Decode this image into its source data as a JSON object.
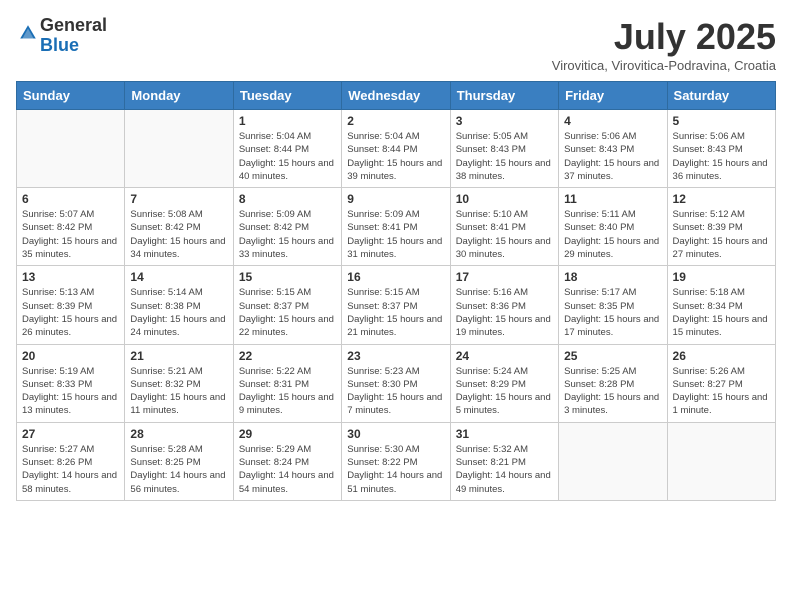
{
  "logo": {
    "general": "General",
    "blue": "Blue"
  },
  "title": "July 2025",
  "subtitle": "Virovitica, Virovitica-Podravina, Croatia",
  "days_of_week": [
    "Sunday",
    "Monday",
    "Tuesday",
    "Wednesday",
    "Thursday",
    "Friday",
    "Saturday"
  ],
  "weeks": [
    [
      {
        "day": "",
        "sunrise": "",
        "sunset": "",
        "daylight": ""
      },
      {
        "day": "",
        "sunrise": "",
        "sunset": "",
        "daylight": ""
      },
      {
        "day": "1",
        "sunrise": "Sunrise: 5:04 AM",
        "sunset": "Sunset: 8:44 PM",
        "daylight": "Daylight: 15 hours and 40 minutes."
      },
      {
        "day": "2",
        "sunrise": "Sunrise: 5:04 AM",
        "sunset": "Sunset: 8:44 PM",
        "daylight": "Daylight: 15 hours and 39 minutes."
      },
      {
        "day": "3",
        "sunrise": "Sunrise: 5:05 AM",
        "sunset": "Sunset: 8:43 PM",
        "daylight": "Daylight: 15 hours and 38 minutes."
      },
      {
        "day": "4",
        "sunrise": "Sunrise: 5:06 AM",
        "sunset": "Sunset: 8:43 PM",
        "daylight": "Daylight: 15 hours and 37 minutes."
      },
      {
        "day": "5",
        "sunrise": "Sunrise: 5:06 AM",
        "sunset": "Sunset: 8:43 PM",
        "daylight": "Daylight: 15 hours and 36 minutes."
      }
    ],
    [
      {
        "day": "6",
        "sunrise": "Sunrise: 5:07 AM",
        "sunset": "Sunset: 8:42 PM",
        "daylight": "Daylight: 15 hours and 35 minutes."
      },
      {
        "day": "7",
        "sunrise": "Sunrise: 5:08 AM",
        "sunset": "Sunset: 8:42 PM",
        "daylight": "Daylight: 15 hours and 34 minutes."
      },
      {
        "day": "8",
        "sunrise": "Sunrise: 5:09 AM",
        "sunset": "Sunset: 8:42 PM",
        "daylight": "Daylight: 15 hours and 33 minutes."
      },
      {
        "day": "9",
        "sunrise": "Sunrise: 5:09 AM",
        "sunset": "Sunset: 8:41 PM",
        "daylight": "Daylight: 15 hours and 31 minutes."
      },
      {
        "day": "10",
        "sunrise": "Sunrise: 5:10 AM",
        "sunset": "Sunset: 8:41 PM",
        "daylight": "Daylight: 15 hours and 30 minutes."
      },
      {
        "day": "11",
        "sunrise": "Sunrise: 5:11 AM",
        "sunset": "Sunset: 8:40 PM",
        "daylight": "Daylight: 15 hours and 29 minutes."
      },
      {
        "day": "12",
        "sunrise": "Sunrise: 5:12 AM",
        "sunset": "Sunset: 8:39 PM",
        "daylight": "Daylight: 15 hours and 27 minutes."
      }
    ],
    [
      {
        "day": "13",
        "sunrise": "Sunrise: 5:13 AM",
        "sunset": "Sunset: 8:39 PM",
        "daylight": "Daylight: 15 hours and 26 minutes."
      },
      {
        "day": "14",
        "sunrise": "Sunrise: 5:14 AM",
        "sunset": "Sunset: 8:38 PM",
        "daylight": "Daylight: 15 hours and 24 minutes."
      },
      {
        "day": "15",
        "sunrise": "Sunrise: 5:15 AM",
        "sunset": "Sunset: 8:37 PM",
        "daylight": "Daylight: 15 hours and 22 minutes."
      },
      {
        "day": "16",
        "sunrise": "Sunrise: 5:15 AM",
        "sunset": "Sunset: 8:37 PM",
        "daylight": "Daylight: 15 hours and 21 minutes."
      },
      {
        "day": "17",
        "sunrise": "Sunrise: 5:16 AM",
        "sunset": "Sunset: 8:36 PM",
        "daylight": "Daylight: 15 hours and 19 minutes."
      },
      {
        "day": "18",
        "sunrise": "Sunrise: 5:17 AM",
        "sunset": "Sunset: 8:35 PM",
        "daylight": "Daylight: 15 hours and 17 minutes."
      },
      {
        "day": "19",
        "sunrise": "Sunrise: 5:18 AM",
        "sunset": "Sunset: 8:34 PM",
        "daylight": "Daylight: 15 hours and 15 minutes."
      }
    ],
    [
      {
        "day": "20",
        "sunrise": "Sunrise: 5:19 AM",
        "sunset": "Sunset: 8:33 PM",
        "daylight": "Daylight: 15 hours and 13 minutes."
      },
      {
        "day": "21",
        "sunrise": "Sunrise: 5:21 AM",
        "sunset": "Sunset: 8:32 PM",
        "daylight": "Daylight: 15 hours and 11 minutes."
      },
      {
        "day": "22",
        "sunrise": "Sunrise: 5:22 AM",
        "sunset": "Sunset: 8:31 PM",
        "daylight": "Daylight: 15 hours and 9 minutes."
      },
      {
        "day": "23",
        "sunrise": "Sunrise: 5:23 AM",
        "sunset": "Sunset: 8:30 PM",
        "daylight": "Daylight: 15 hours and 7 minutes."
      },
      {
        "day": "24",
        "sunrise": "Sunrise: 5:24 AM",
        "sunset": "Sunset: 8:29 PM",
        "daylight": "Daylight: 15 hours and 5 minutes."
      },
      {
        "day": "25",
        "sunrise": "Sunrise: 5:25 AM",
        "sunset": "Sunset: 8:28 PM",
        "daylight": "Daylight: 15 hours and 3 minutes."
      },
      {
        "day": "26",
        "sunrise": "Sunrise: 5:26 AM",
        "sunset": "Sunset: 8:27 PM",
        "daylight": "Daylight: 15 hours and 1 minute."
      }
    ],
    [
      {
        "day": "27",
        "sunrise": "Sunrise: 5:27 AM",
        "sunset": "Sunset: 8:26 PM",
        "daylight": "Daylight: 14 hours and 58 minutes."
      },
      {
        "day": "28",
        "sunrise": "Sunrise: 5:28 AM",
        "sunset": "Sunset: 8:25 PM",
        "daylight": "Daylight: 14 hours and 56 minutes."
      },
      {
        "day": "29",
        "sunrise": "Sunrise: 5:29 AM",
        "sunset": "Sunset: 8:24 PM",
        "daylight": "Daylight: 14 hours and 54 minutes."
      },
      {
        "day": "30",
        "sunrise": "Sunrise: 5:30 AM",
        "sunset": "Sunset: 8:22 PM",
        "daylight": "Daylight: 14 hours and 51 minutes."
      },
      {
        "day": "31",
        "sunrise": "Sunrise: 5:32 AM",
        "sunset": "Sunset: 8:21 PM",
        "daylight": "Daylight: 14 hours and 49 minutes."
      },
      {
        "day": "",
        "sunrise": "",
        "sunset": "",
        "daylight": ""
      },
      {
        "day": "",
        "sunrise": "",
        "sunset": "",
        "daylight": ""
      }
    ]
  ]
}
